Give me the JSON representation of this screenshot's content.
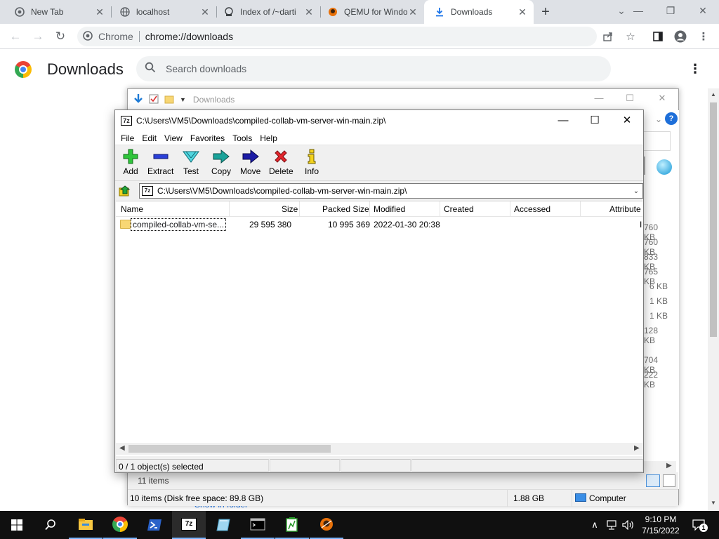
{
  "browser": {
    "tabs": [
      {
        "label": "New Tab",
        "icon": "chrome-icon"
      },
      {
        "label": "localhost",
        "icon": "globe-icon"
      },
      {
        "label": "Index of /~darti",
        "icon": "server-icon"
      },
      {
        "label": "QEMU for Windo",
        "icon": "qemu-icon"
      },
      {
        "label": "Downloads",
        "icon": "download-icon"
      }
    ],
    "omnibox_chip": "Chrome",
    "omnibox_url": "chrome://downloads"
  },
  "downloads_page": {
    "title": "Downloads",
    "search_placeholder": "Search downloads",
    "show_in_folder": "Show in folder"
  },
  "explorer": {
    "title": "Downloads",
    "sizes": [
      "760 KB",
      "760 KB",
      "833 KB",
      "765 KB",
      "6 KB",
      "1 KB",
      "1 KB",
      "128 KB",
      "",
      "704 KB",
      "222 KB"
    ],
    "items_count": "11 items",
    "status_items": "10 items (Disk free space: 89.8 GB)",
    "status_size": "1.88 GB",
    "status_location": "Computer"
  },
  "sevenzip": {
    "title": "C:\\Users\\VM5\\Downloads\\compiled-collab-vm-server-win-main.zip\\",
    "menu": [
      "File",
      "Edit",
      "View",
      "Favorites",
      "Tools",
      "Help"
    ],
    "toolbar": {
      "add": "Add",
      "extract": "Extract",
      "test": "Test",
      "copy": "Copy",
      "move": "Move",
      "delete": "Delete",
      "info": "Info"
    },
    "address": "C:\\Users\\VM5\\Downloads\\compiled-collab-vm-server-win-main.zip\\",
    "columns": {
      "name": "Name",
      "size": "Size",
      "packed": "Packed Size",
      "modified": "Modified",
      "created": "Created",
      "accessed": "Accessed",
      "attributes": "Attribute"
    },
    "rows": [
      {
        "name": "compiled-collab-vm-se...",
        "size": "29 595 380",
        "packed": "10 995 369",
        "modified": "2022-01-30 20:38",
        "created": "",
        "accessed": "",
        "attributes": "I"
      }
    ],
    "status": "0 / 1 object(s) selected"
  },
  "taskbar": {
    "time": "9:10 PM",
    "date": "7/15/2022",
    "notification_count": "1"
  }
}
